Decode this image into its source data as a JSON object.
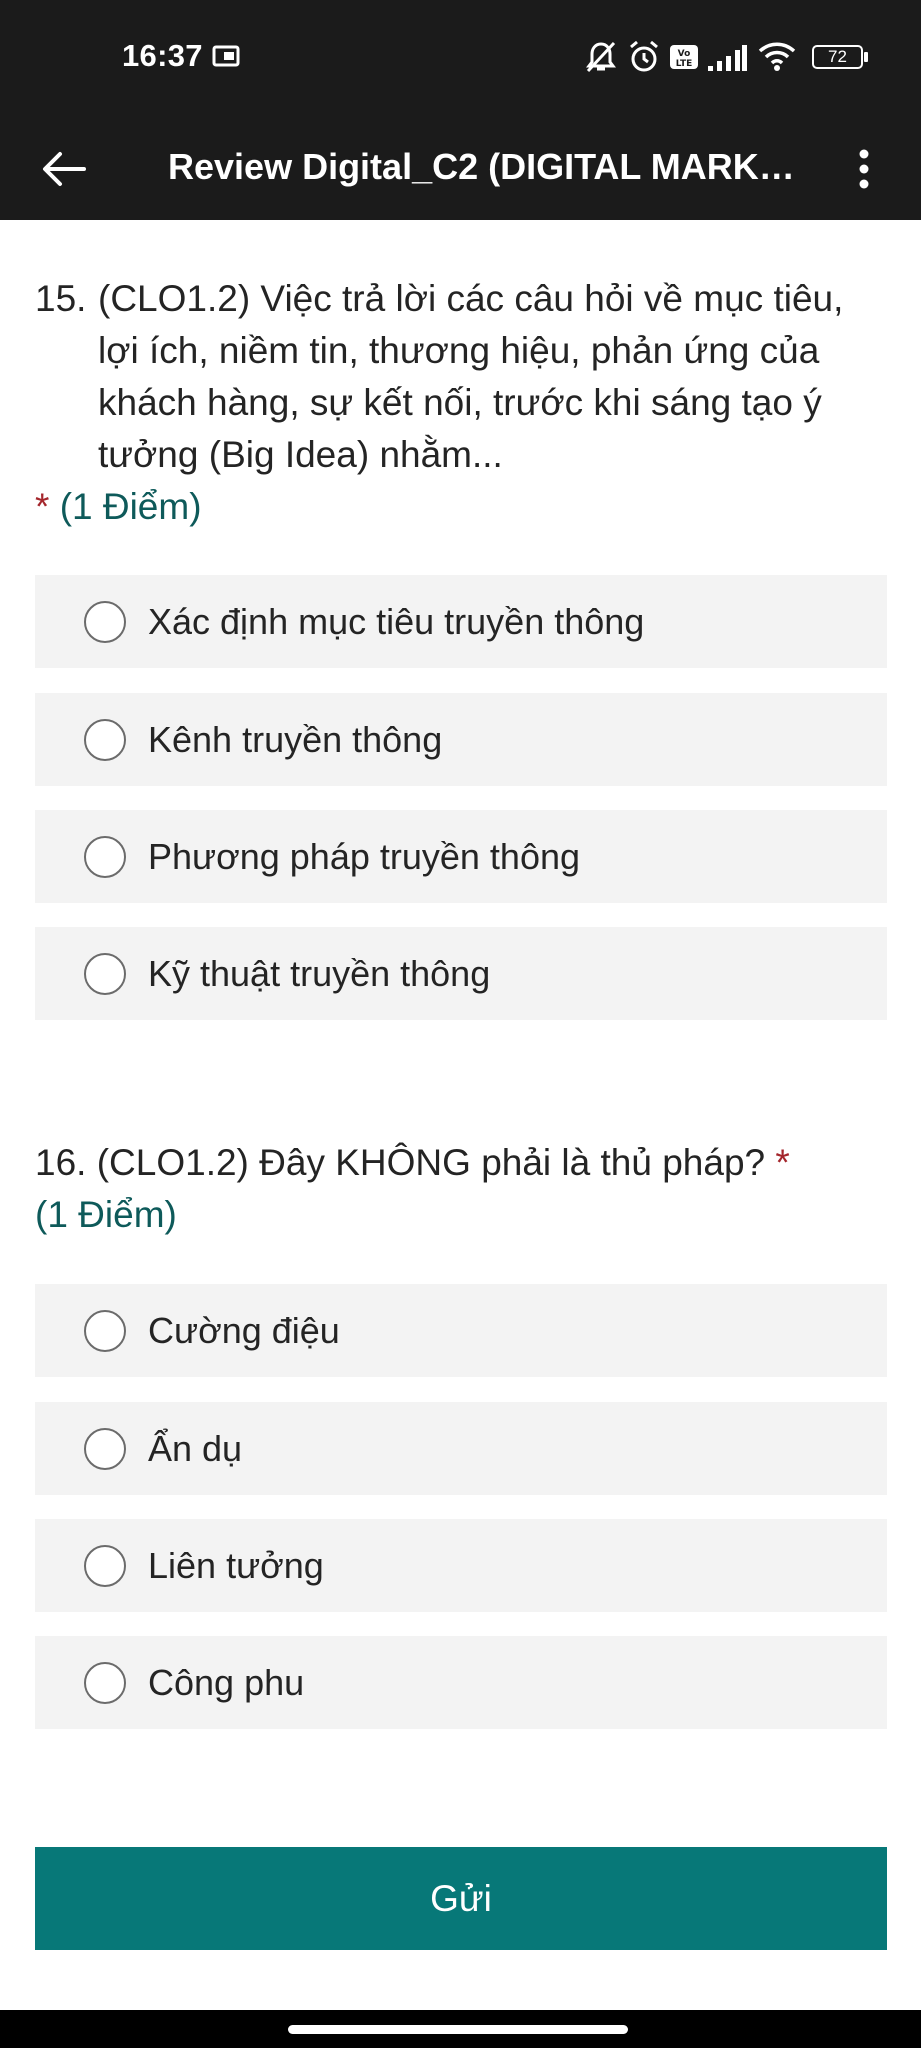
{
  "status_bar": {
    "time": "16:37",
    "battery": "72",
    "icons": [
      "notification-icon",
      "mute-icon",
      "alarm-icon",
      "volte-icon",
      "signal-icon",
      "wifi-icon",
      "battery-icon"
    ]
  },
  "app_bar": {
    "title": "Review Digital_C2 (DIGITAL MARKE...",
    "back_icon": "back-arrow-icon",
    "more_icon": "more-vert-icon"
  },
  "questions": [
    {
      "number": "15.",
      "text": "(CLO1.2) Việc trả lời các câu hỏi về mục tiêu, lợi ích, niềm tin, thương hiệu, phản ứng của khách hàng, sự kết nối, trước khi sáng tạo ý tưởng (Big Idea) nhằm...",
      "required_mark": "*",
      "points": "(1 Điểm)",
      "options": [
        "Xác định mục tiêu truyền thông",
        "Kênh truyền thông",
        "Phương pháp truyền thông",
        "Kỹ thuật truyền thông"
      ]
    },
    {
      "number": "16.",
      "text": "(CLO1.2) Đây KHÔNG phải là thủ pháp?",
      "required_mark": "*",
      "points": "(1 Điểm)",
      "options": [
        "Cường điệu",
        "Ẩn dụ",
        "Liên tưởng",
        "Công phu"
      ]
    }
  ],
  "submit": {
    "label": "Gửi"
  },
  "colors": {
    "header_bg": "#1b1b1b",
    "accent": "#077878",
    "points_text": "#0e5a5a",
    "required": "#a4262c",
    "option_bg": "#f3f3f3"
  }
}
